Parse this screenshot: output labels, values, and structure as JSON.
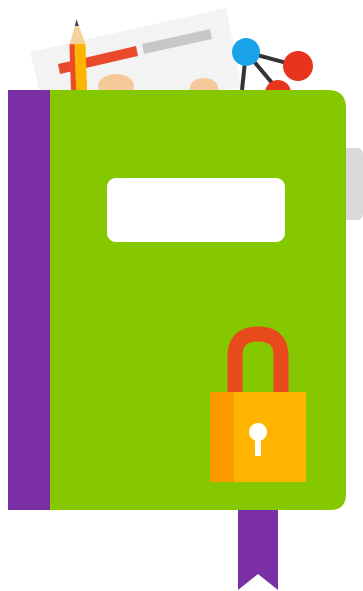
{
  "illustration": {
    "subject": "locked-notebook",
    "colors": {
      "cover": "#86c800",
      "spine": "#7b2fa5",
      "bookmark": "#7b2fa5",
      "label": "#ffffff",
      "side_tab": "#d9d9d9",
      "paper": "#f3f3f3",
      "paper_bar_red": "#e84a2a",
      "paper_bar_gray": "#c8c8c8",
      "pencil_body": "#ffb400",
      "pencil_band": "#e84a2a",
      "pencil_wood": "#f5d29b",
      "pencil_tip": "#444444",
      "molecule_blue": "#1aa3e8",
      "molecule_red": "#e8341c",
      "molecule_link": "#333333",
      "padlock_body": "#ffb400",
      "padlock_body_shade": "#ff9a00",
      "padlock_shackle": "#e84a1c",
      "keyhole": "#ffffff",
      "peach_blobs": "#f6c99a"
    },
    "icons": [
      "notebook-icon",
      "padlock-icon",
      "keyhole-icon",
      "pencil-icon",
      "molecule-icon",
      "bookmark-icon"
    ]
  }
}
